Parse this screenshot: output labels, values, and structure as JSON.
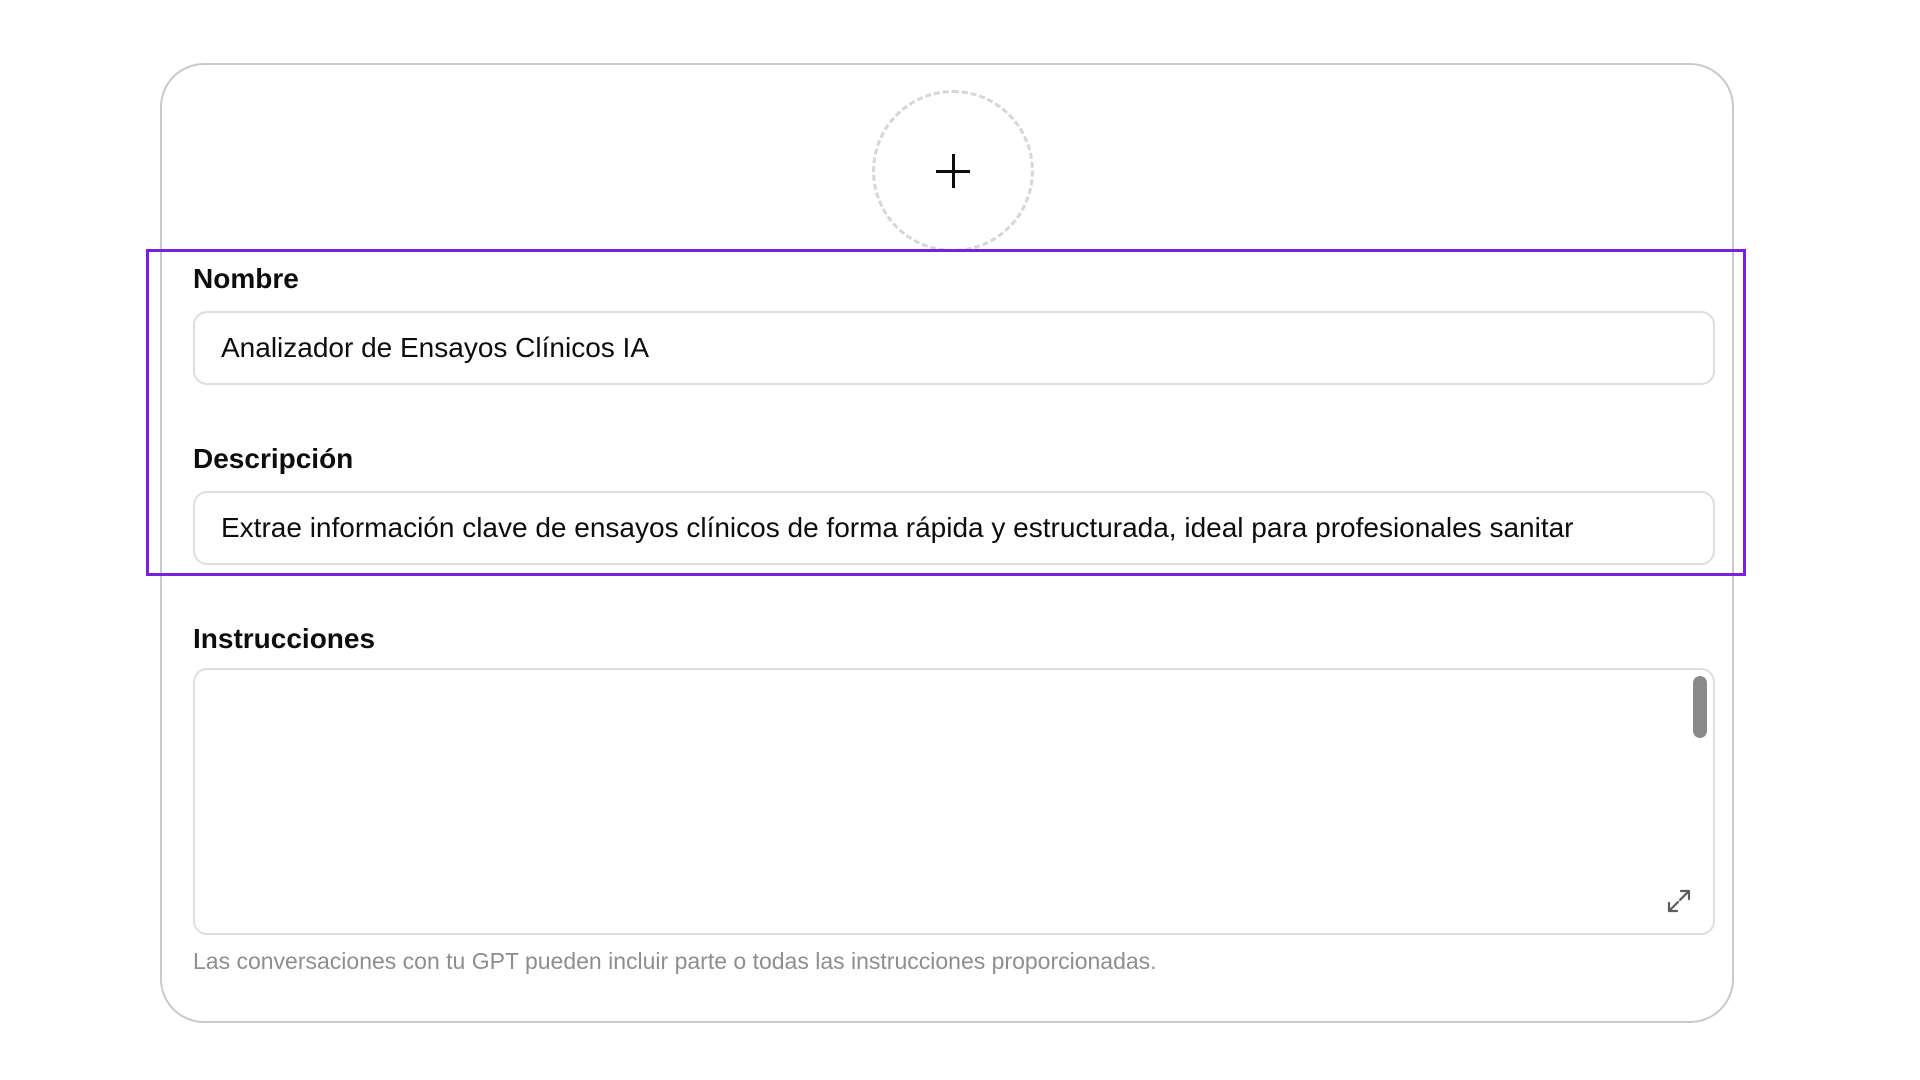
{
  "avatar": {
    "icon": "plus-icon"
  },
  "form": {
    "name": {
      "label": "Nombre",
      "value": "Analizador de Ensayos Clínicos IA"
    },
    "description": {
      "label": "Descripción",
      "value": "Extrae información clave de ensayos clínicos de forma rápida y estructurada, ideal para profesionales sanitar"
    },
    "instructions": {
      "label": "Instrucciones",
      "value": "",
      "expand_icon": "expand-icon",
      "hint": "Las conversaciones con tu GPT pueden incluir parte o todas las instrucciones proporcionadas."
    }
  },
  "colors": {
    "highlight": "#7a1fe0",
    "border": "#c9c9c9",
    "hint": "#8e8e8e"
  }
}
